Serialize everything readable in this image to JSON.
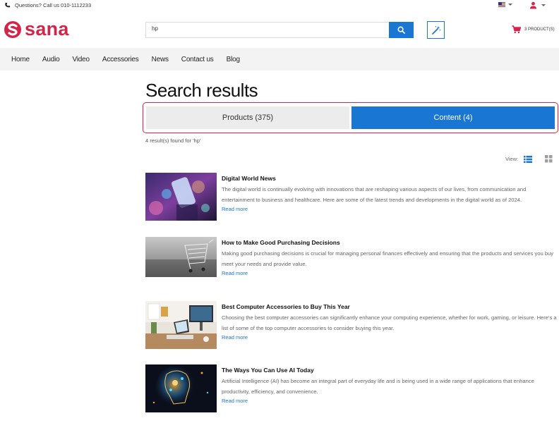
{
  "topbar": {
    "phone_text": "Questions? Call us 010-1112233"
  },
  "header": {
    "logo_text": "sana",
    "search_value": "hp",
    "cart_text": "3 PRODUCT(S)"
  },
  "nav": {
    "items": [
      "Home",
      "Audio",
      "Video",
      "Accessories",
      "News",
      "Contact us",
      "Blog"
    ]
  },
  "page": {
    "title": "Search results",
    "tabs": [
      {
        "label": "Products (375)",
        "active": false
      },
      {
        "label": "Content (4)",
        "active": true
      }
    ],
    "result_count": "4 result(s) found for 'hp'",
    "view_label": "View:"
  },
  "results": [
    {
      "title": "Digital World News",
      "description": "The digital world is continually evolving with innovations that are reshaping various aspects of our lives, from communication and entertainment to business and healthcare. Here are some of the latest trends and developments in the digital world as of 2024.",
      "link": "Read more",
      "image": "smartphone-bokeh-image"
    },
    {
      "title": "How to Make Good Purchasing Decisions",
      "description": "Making good purchasing decisions is crucial for managing personal finances effectively and ensuring that the products and services you buy meet your needs and provide value.",
      "link": "Read more",
      "image": "shopping-cart-image"
    },
    {
      "title": "Best Computer Accessories to Buy This Year",
      "description": "Choosing the best computer accessories can significantly enhance your computing experience, whether for work, gaming, or leisure. Here's a list of some of the top computer accessories to consider buying this year.",
      "link": "Read more",
      "image": "desk-workspace-image"
    },
    {
      "title": "The Ways You Can Use AI Today",
      "description": "Artificial Intelligence (AI) has become an integral part of everyday life and is being used in a wide range of applications that enhance productivity, efficiency, and convenience.",
      "link": "Read more",
      "image": "ai-head-image"
    }
  ],
  "colors": {
    "brand": "#d3254a",
    "accent": "#1976d2"
  }
}
